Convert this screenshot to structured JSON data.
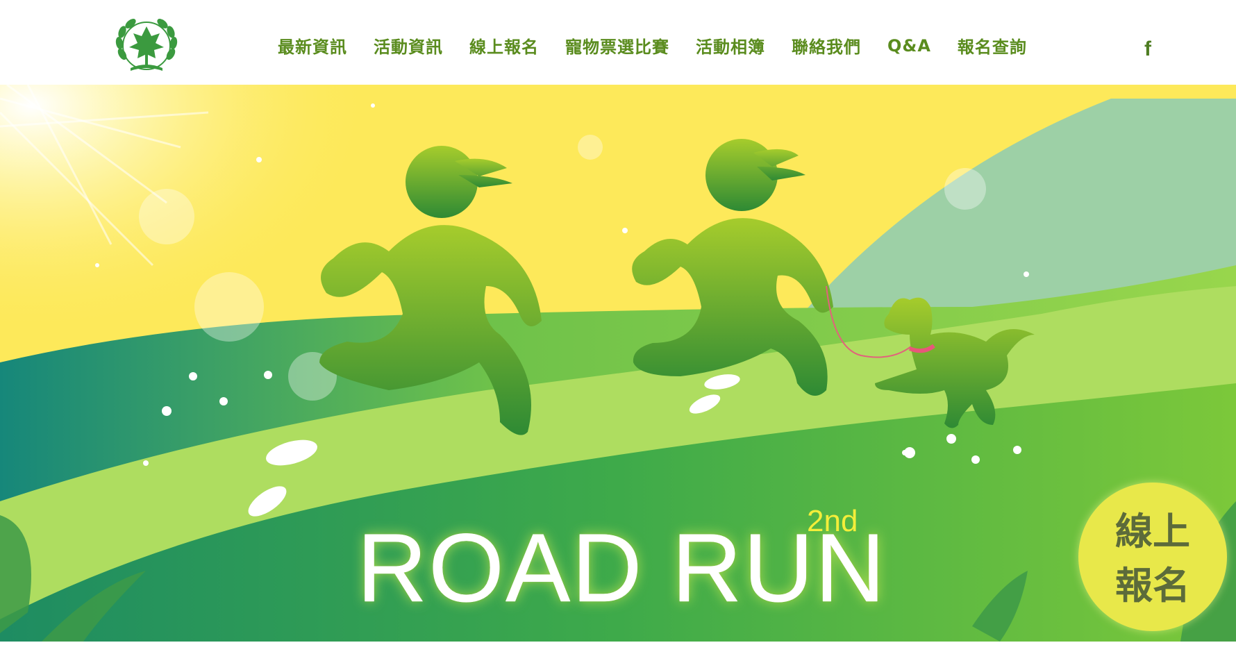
{
  "nav": {
    "items": [
      {
        "label": "最新資訊"
      },
      {
        "label": "活動資訊"
      },
      {
        "label": "線上報名"
      },
      {
        "label": "寵物票選比賽"
      },
      {
        "label": "活動相簿"
      },
      {
        "label": "聯絡我們"
      },
      {
        "label": "Q&A"
      },
      {
        "label": "報名查詢"
      }
    ],
    "facebook_icon": "facebook-icon"
  },
  "hero": {
    "title_edition": "2nd",
    "title": "ROAD RUN",
    "signup_badge": {
      "line1": "線上",
      "line2": "報名"
    }
  },
  "colors": {
    "nav_text": "#5a8c1e",
    "sky": "#fde95a",
    "mountain": "#9dd0a6",
    "grass_light": "#a8dd5c",
    "grass_dark": "#2c9a55",
    "runner": "#62ab2a",
    "badge": "#e8e84a"
  }
}
